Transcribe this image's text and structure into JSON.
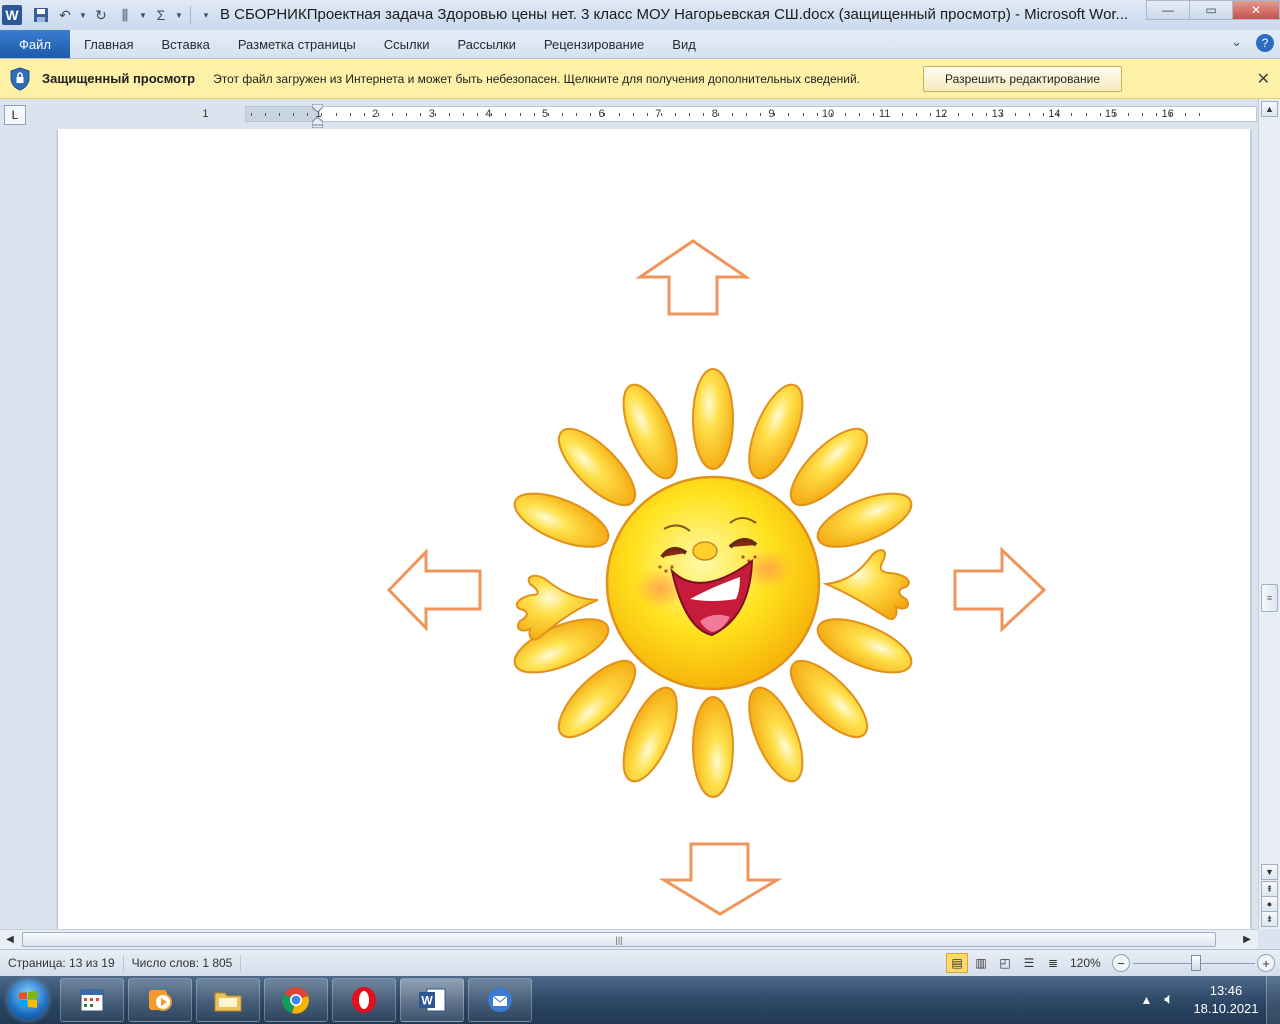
{
  "window": {
    "title": "В СБОРНИКПроектная задача Здоровью цены нет. 3 класс МОУ Нагорьевская СШ.docx (защищенный просмотр)  -  Microsoft Wor...",
    "app_icon_letter": "W",
    "controls": {
      "minimize": "—",
      "maximize": "▭",
      "close": "✕"
    }
  },
  "quick_access": {
    "items": [
      "save-icon",
      "undo-icon",
      "redo-icon",
      "columns-icon",
      "sum-icon",
      "customize-icon"
    ]
  },
  "ribbon": {
    "file_tab": "Файл",
    "tabs": [
      "Главная",
      "Вставка",
      "Разметка страницы",
      "Ссылки",
      "Рассылки",
      "Рецензирование",
      "Вид"
    ],
    "help": "?",
    "collapse": "⌄"
  },
  "protected_view": {
    "title": "Защищенный просмотр",
    "message": "Этот файл загружен из Интернета и может быть небезопасен. Щелкните для получения дополнительных сведений.",
    "enable_button": "Разрешить редактирование",
    "close": "✕",
    "accent": "#fdf0a7"
  },
  "ruler": {
    "tab_selector": "L",
    "labels": [
      "1",
      "1",
      "2",
      "3",
      "4",
      "5",
      "6",
      "7",
      "8",
      "9",
      "10",
      "11",
      "12",
      "13",
      "14",
      "15",
      "16"
    ]
  },
  "document": {
    "content": "sun-illustration-with-four-arrows",
    "arrow_color": "#f0955a",
    "sun_color": "#ffd21a"
  },
  "statusbar": {
    "page": "Страница: 13 из 19",
    "words": "Число слов: 1 805",
    "zoom": "120%",
    "zoom_minus": "−",
    "zoom_plus": "+",
    "zoom_fraction": 0.52,
    "active_view": "print-layout"
  },
  "taskbar": {
    "apps": [
      "calendar-app",
      "media-player",
      "file-explorer",
      "chrome",
      "opera",
      "microsoft-word",
      "thunderbird"
    ],
    "time": "13:46",
    "date": "18.10.2021"
  }
}
